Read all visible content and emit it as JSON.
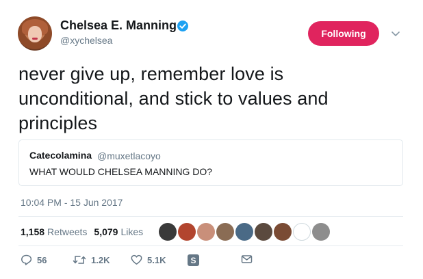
{
  "header": {
    "display_name": "Chelsea E. Manning",
    "handle": "@xychelsea",
    "follow_label": "Following"
  },
  "tweet": {
    "text": "never give up, remember love is unconditional, and stick to values and principles",
    "timestamp": "10:04 PM - 15 Jun 2017"
  },
  "quote": {
    "name": "Catecolamina",
    "handle": "@muxetlacoyo",
    "text": "WHAT WOULD CHELSEA MANNING DO?"
  },
  "stats": {
    "retweets_count": "1,158",
    "retweets_label": "Retweets",
    "likes_count": "5,079",
    "likes_label": "Likes"
  },
  "actions": {
    "reply_count": "56",
    "retweet_count": "1.2K",
    "like_count": "5.1K"
  },
  "colors": {
    "accent_follow": "#e0245e",
    "verified": "#1da1f2",
    "muted_text": "#657786"
  },
  "likers": [
    {
      "color": "#3a3a3a"
    },
    {
      "color": "#b2452e"
    },
    {
      "color": "#c98f7a"
    },
    {
      "color": "#8a6c54"
    },
    {
      "color": "#4a6a86"
    },
    {
      "color": "#5b4a3e"
    },
    {
      "color": "#7a4b34"
    },
    {
      "color": "#ffffff"
    },
    {
      "color": "#8d8d8d"
    }
  ]
}
